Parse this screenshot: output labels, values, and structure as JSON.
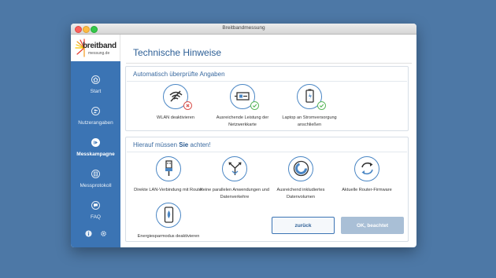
{
  "window": {
    "title": "Breitbandmessung"
  },
  "logo": {
    "name": "breitband",
    "sub": "messung.de"
  },
  "sidebar": {
    "items": [
      {
        "label": "Start",
        "icon": "home-icon"
      },
      {
        "label": "Nutzerangaben",
        "icon": "users-icon"
      },
      {
        "label": "Messkampagne",
        "icon": "play-icon"
      },
      {
        "label": "Messprotokoll",
        "icon": "document-icon"
      },
      {
        "label": "FAQ",
        "icon": "chat-icon"
      }
    ],
    "bottom": {
      "info_icon": "info-icon",
      "settings_icon": "gear-icon"
    }
  },
  "main": {
    "title": "Technische Hinweise",
    "section1": {
      "heading": "Automatisch überprüfte Angaben",
      "items": [
        {
          "label": "WLAN deaktivieren",
          "icon": "wifi-off-icon",
          "status": "error"
        },
        {
          "label": "Ausreichende Leistung der Netzwerkkarte",
          "icon": "network-card-icon",
          "status": "ok"
        },
        {
          "label": "Laptop an Stromversorgung anschließen",
          "icon": "battery-plug-icon",
          "status": "ok"
        }
      ]
    },
    "section2": {
      "heading_prefix": "Hierauf müssen ",
      "heading_bold": "Sie",
      "heading_suffix": " achten!",
      "items": [
        {
          "label": "Direkte LAN-Verbindung mit Router",
          "icon": "lan-plug-icon"
        },
        {
          "label": "Keine parallelen Anwendungen und Datenverkehre",
          "icon": "parallel-arrows-icon"
        },
        {
          "label": "Ausreichend inkludiertes Datenvolumen",
          "icon": "data-volume-icon"
        },
        {
          "label": "Aktuelle Router-Firmware",
          "icon": "refresh-icon"
        },
        {
          "label": "Energiesparmodus deaktivieren",
          "icon": "phone-leaf-icon"
        }
      ]
    },
    "buttons": {
      "back": "zurück",
      "ok": "OK, beachtet"
    }
  },
  "colors": {
    "background": "#4d78a6",
    "sidebar": "#3b74b4",
    "accent": "#4a86c4",
    "error": "#d9534f",
    "ok": "#5cb85c"
  }
}
